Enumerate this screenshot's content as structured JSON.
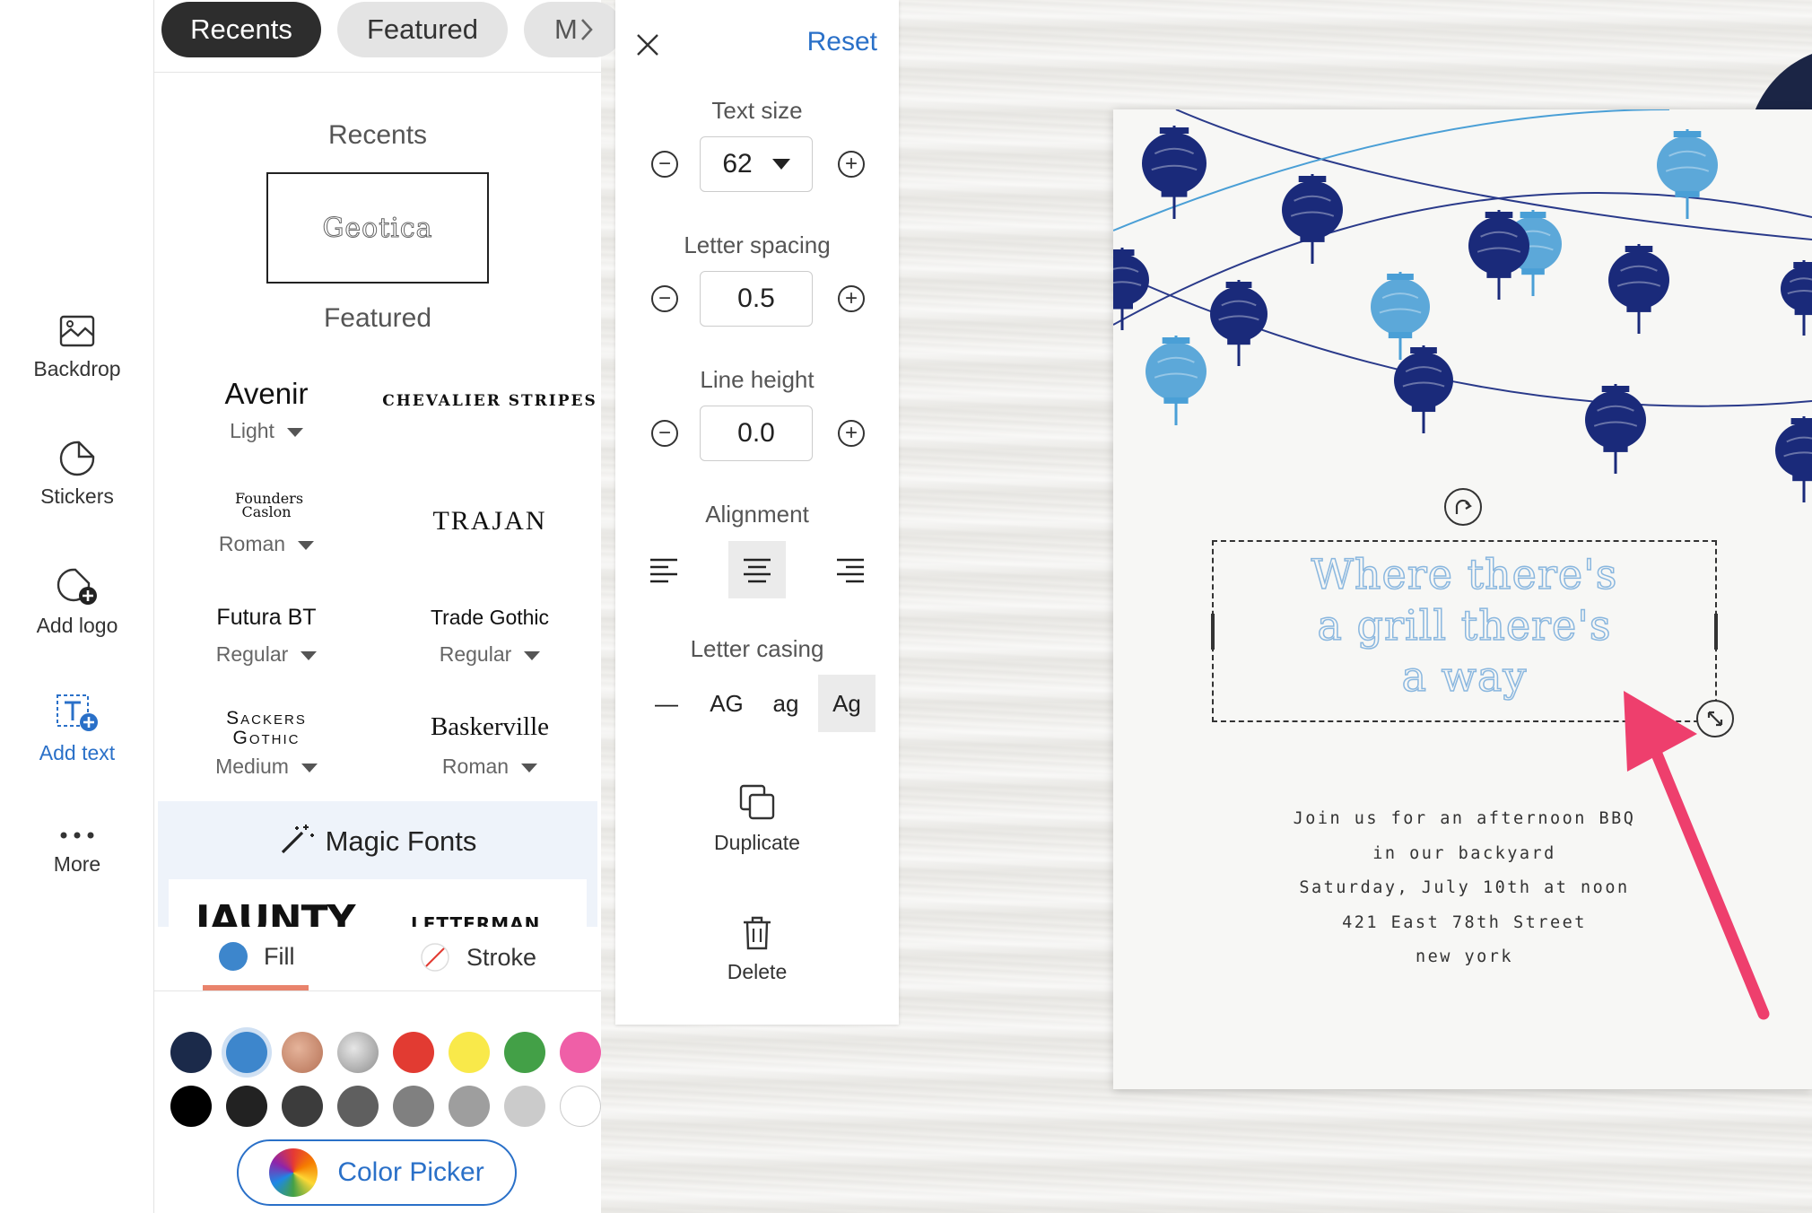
{
  "nav": {
    "backdrop": "Backdrop",
    "stickers": "Stickers",
    "add_logo": "Add logo",
    "add_text": "Add text",
    "more": "More"
  },
  "font_panel": {
    "tabs": [
      "Recents",
      "Featured",
      "M"
    ],
    "recents_title": "Recents",
    "recent_font": "Geotica",
    "featured_title": "Featured",
    "fonts": [
      {
        "name": "Avenir",
        "variant": "Light"
      },
      {
        "name": "Chevalier Stripes",
        "variant": ""
      },
      {
        "name": "Founders Caslon",
        "variant": "Roman"
      },
      {
        "name": "Trajan",
        "variant": ""
      },
      {
        "name": "Futura BT",
        "variant": "Regular"
      },
      {
        "name": "Trade Gothic",
        "variant": "Regular"
      },
      {
        "name": "Sackers Gothic",
        "variant": "Medium"
      },
      {
        "name": "Baskerville",
        "variant": "Roman"
      }
    ],
    "magic_title": "Magic Fonts",
    "magic_samples": [
      "JAUNTY",
      "LETTERMAN"
    ],
    "fill_label": "Fill",
    "stroke_label": "Stroke",
    "swatches_row1": [
      "#1b2a4a",
      "#3d86cc",
      "#c98d6e",
      "#a9a9a9",
      "#e23b32",
      "#f9e94a",
      "#43a047",
      "#ef5fa7"
    ],
    "swatches_row2": [
      "#000000",
      "#222222",
      "#3c3c3c",
      "#5f5f5f",
      "#808080",
      "#9e9e9e",
      "#cbcbcb",
      "#ffffff"
    ],
    "color_picker": "Color Picker"
  },
  "text_panel": {
    "reset": "Reset",
    "text_size_label": "Text size",
    "text_size": "62",
    "letter_spacing_label": "Letter spacing",
    "letter_spacing": "0.5",
    "line_height_label": "Line height",
    "line_height": "0.0",
    "alignment_label": "Alignment",
    "alignment_selected": "center",
    "letter_casing_label": "Letter casing",
    "casing_options": [
      "—",
      "AG",
      "ag",
      "Ag"
    ],
    "casing_selected": "Ag",
    "duplicate": "Duplicate",
    "delete": "Delete"
  },
  "card": {
    "headline": [
      "Where there's",
      "a grill there's",
      "a way"
    ],
    "details": [
      "Join us for an afternoon BBQ",
      "in our backyard",
      "Saturday, July 10th at noon",
      "421 East 78th Street",
      "new york"
    ],
    "colors": {
      "dark_lantern": "#1a2a7a",
      "light_lantern": "#4a9fd6",
      "headline_outline": "#8ab7df",
      "arrow": "#ee3f6d"
    }
  }
}
